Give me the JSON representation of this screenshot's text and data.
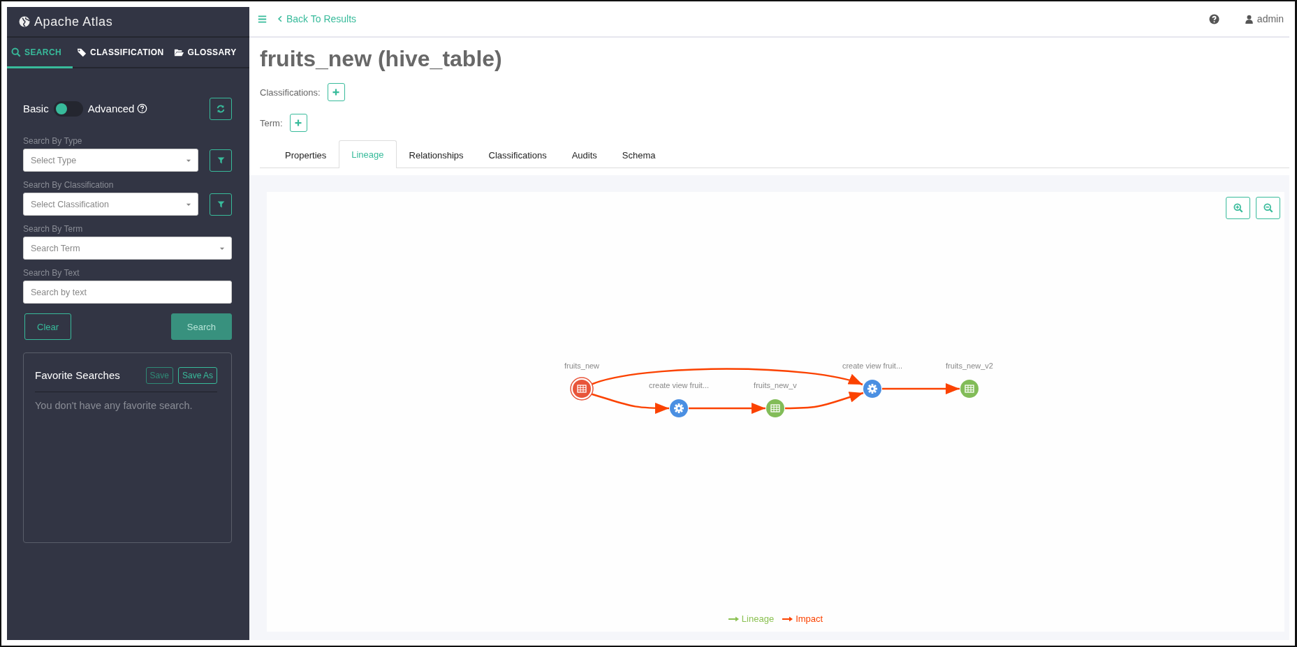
{
  "app": {
    "title": "Apache Atlas"
  },
  "sidebar": {
    "tabs": [
      {
        "label": "SEARCH",
        "selected": true
      },
      {
        "label": "CLASSIFICATION",
        "selected": false
      },
      {
        "label": "GLOSSARY",
        "selected": false
      }
    ],
    "mode_toggle": {
      "left_label": "Basic",
      "right_label": "Advanced",
      "on": false
    },
    "fields": [
      {
        "label": "Search By Type",
        "placeholder": "Select Type",
        "kind": "select",
        "filter": true
      },
      {
        "label": "Search By Classification",
        "placeholder": "Select Classification",
        "kind": "select",
        "filter": true
      },
      {
        "label": "Search By Term",
        "placeholder": "Search Term",
        "kind": "select",
        "filter": false
      },
      {
        "label": "Search By Text",
        "placeholder": "Search by text",
        "kind": "text",
        "filter": false
      }
    ],
    "buttons": [
      {
        "label": "Clear",
        "kind": "outline"
      },
      {
        "label": "Search",
        "kind": "primary"
      }
    ],
    "favorites": {
      "title": "Favorite Searches",
      "buttons": [
        {
          "label": "Save",
          "disabled": true
        },
        {
          "label": "Save As",
          "disabled": false
        }
      ],
      "empty_text": "You don't have any favorite search."
    }
  },
  "header": {
    "back_link": "Back To Results",
    "user": "admin"
  },
  "entity": {
    "title": "fruits_new (hive_table)",
    "classifications_label": "Classifications:",
    "term_label": "Term:",
    "tabs": [
      {
        "label": "Properties",
        "selected": false
      },
      {
        "label": "Lineage",
        "selected": true
      },
      {
        "label": "Relationships",
        "selected": false
      },
      {
        "label": "Classifications",
        "selected": false
      },
      {
        "label": "Audits",
        "selected": false
      },
      {
        "label": "Schema",
        "selected": false
      }
    ]
  },
  "lineage": {
    "nodes": [
      {
        "label": "fruits_new",
        "kind": "table",
        "current": true
      },
      {
        "label": "create view fruit...",
        "kind": "process",
        "current": false
      },
      {
        "label": "fruits_new_v",
        "kind": "table",
        "current": false
      },
      {
        "label": "create view fruit...",
        "kind": "process",
        "current": false
      },
      {
        "label": "fruits_new_v2",
        "kind": "table",
        "current": false
      }
    ],
    "legend": [
      {
        "label": "Lineage",
        "kind": "lineage",
        "color": "#8bc152"
      },
      {
        "label": "Impact",
        "kind": "impact",
        "color": "#fb4200"
      }
    ]
  }
}
